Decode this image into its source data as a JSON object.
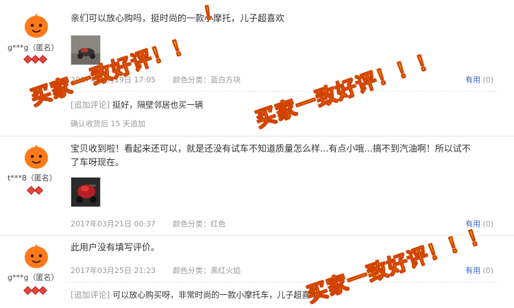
{
  "reviews": [
    {
      "username": "g***g（匿名）",
      "text": "亲们可以放心购吗，挺时尚的一款小摩托，儿子超喜欢",
      "date": "2017年04月19日 17:05",
      "color_label": "颜色分类：",
      "color_value": "蓝白方块",
      "useful_label": "有用",
      "useful_count": "(0)",
      "append_tag": "[追加评论]",
      "append_text": "挺好，隔壁邻居也买一辆",
      "append_note": "确认收货后 15 天追加"
    },
    {
      "username": "t***8（匿名）",
      "text_line1": "宝贝收到啦！看起来还可以，就是还没有试车不知道质量怎么样...有点小哦...搞不到汽油啊！所以试不",
      "text_line2": "了车呀现在。",
      "date": "2017年03月21日 00:37",
      "color_label": "颜色分类：",
      "color_value": "红色",
      "useful_label": "有用",
      "useful_count": "(0)"
    },
    {
      "username": "g***g（匿名）",
      "text": "此用户没有填写评价。",
      "date": "2017年03月25日 21:23",
      "color_label": "颜色分类：",
      "color_value": "黑红火焰",
      "useful_label": "有用",
      "useful_count": "(0)",
      "append_tag": "[追加评论]",
      "append_text": "可以放心购买呀，非常时尚的一款小摩托车，儿子超喜欢"
    }
  ],
  "watermark": {
    "w1": "买家一致好评！！",
    "w2": "！",
    "w3": "买家一致好评！！！",
    "w4": "买家一致好评！！！"
  },
  "colors": {
    "link": "#3366cc",
    "meta": "#999999",
    "watermark_fill": "#ffd400",
    "watermark_stroke": "#d14300"
  }
}
